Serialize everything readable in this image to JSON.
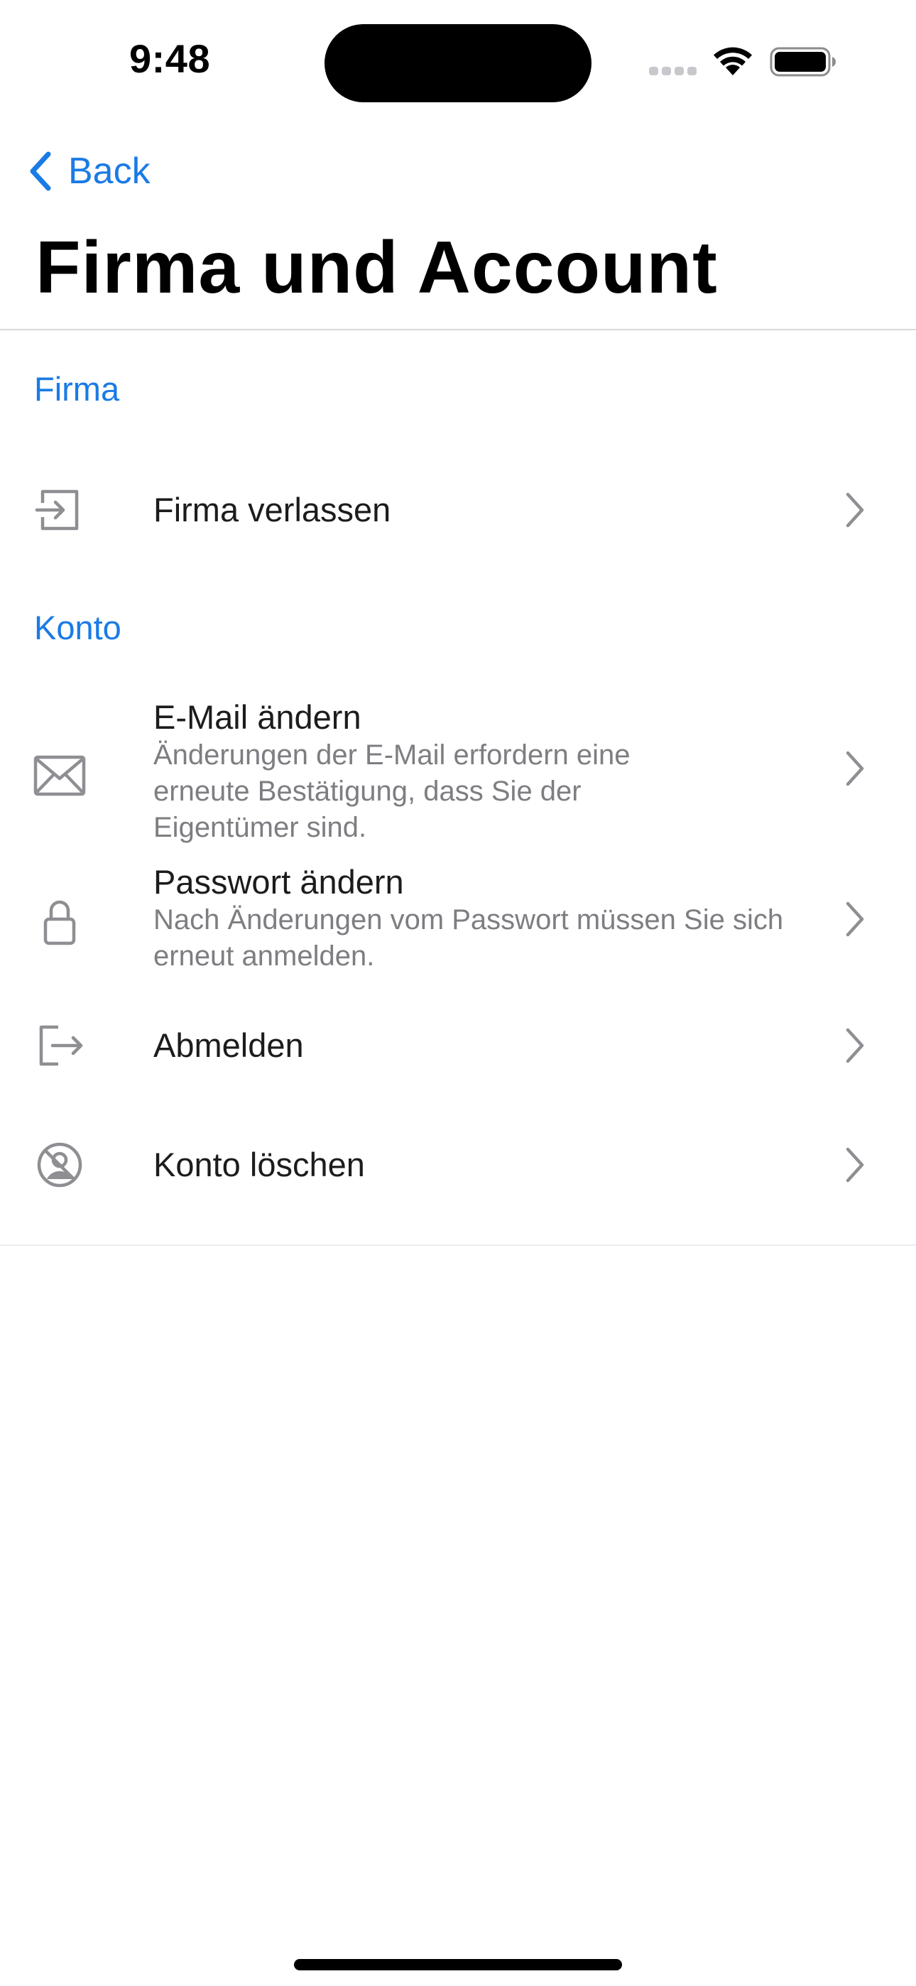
{
  "status_bar": {
    "time": "9:48"
  },
  "nav": {
    "back_label": "Back",
    "title": "Firma und Account"
  },
  "colors": {
    "accent": "#1a7be5",
    "primary_text": "#1c1c1e",
    "secondary_text": "#7d7d82",
    "icon": "#8e8e93",
    "divider": "#d8d8dc"
  },
  "sections": [
    {
      "header": "Firma",
      "items": [
        {
          "icon": "enter-arrow-box-icon",
          "title": "Firma verlassen"
        }
      ]
    },
    {
      "header": "Konto",
      "items": [
        {
          "icon": "envelope-icon",
          "title": "E-Mail ändern",
          "subtitle": "Änderungen der E-Mail erfordern eine erneute Bestätigung, dass Sie der Eigentümer sind."
        },
        {
          "icon": "lock-icon",
          "title": "Passwort ändern",
          "subtitle": "Nach Änderungen vom Passwort müssen Sie sich erneut anmelden."
        },
        {
          "icon": "logout-icon",
          "title": "Abmelden"
        },
        {
          "icon": "delete-account-icon",
          "title": "Konto löschen"
        }
      ]
    }
  ]
}
